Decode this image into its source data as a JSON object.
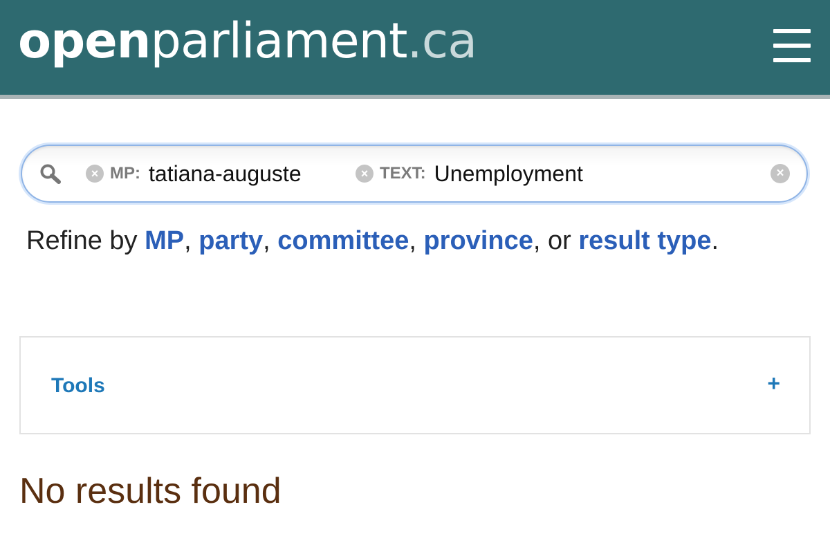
{
  "header": {
    "logo_open": "open",
    "logo_parliament": "parliament",
    "logo_tld": ".ca",
    "menu_icon": "hamburger-menu-icon",
    "bg_color": "#2e6a70"
  },
  "search": {
    "icon": "search-icon",
    "tokens": [
      {
        "key": "MP:",
        "value": "tatiana-auguste"
      },
      {
        "key": "TEXT:",
        "value": "Unemployment"
      }
    ],
    "clear_icon": "clear-icon"
  },
  "refine": {
    "prefix": "Refine by",
    "link_mp": "MP",
    "sep1": ",",
    "link_party": "party",
    "sep2": ",",
    "link_committee": "committee",
    "sep3": ",",
    "link_province": "province",
    "sep4": ", or",
    "link_result_type": "result type",
    "suffix": "."
  },
  "tools": {
    "label": "Tools",
    "toggle": "+"
  },
  "results": {
    "message": "No results found"
  }
}
